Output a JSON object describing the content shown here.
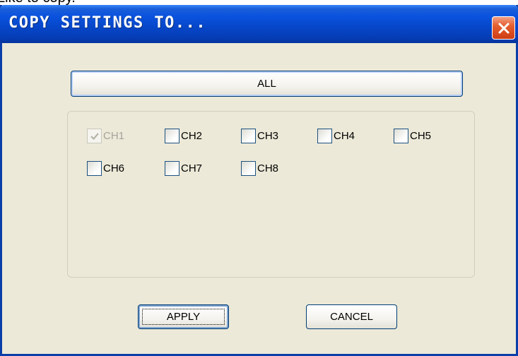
{
  "background_text": "Like to copy.",
  "dialog": {
    "title": "COPY SETTINGS TO...",
    "close_glyph": "close-icon"
  },
  "buttons": {
    "all_label": "ALL",
    "apply_label": "APPLY",
    "cancel_label": "CANCEL"
  },
  "channels": [
    {
      "label": "CH1",
      "checked": true,
      "enabled": false
    },
    {
      "label": "CH2",
      "checked": false,
      "enabled": true
    },
    {
      "label": "CH3",
      "checked": false,
      "enabled": true
    },
    {
      "label": "CH4",
      "checked": false,
      "enabled": true
    },
    {
      "label": "CH5",
      "checked": false,
      "enabled": true
    },
    {
      "label": "CH6",
      "checked": false,
      "enabled": true
    },
    {
      "label": "CH7",
      "checked": false,
      "enabled": true
    },
    {
      "label": "CH8",
      "checked": false,
      "enabled": true
    }
  ],
  "colors": {
    "title_bar": "#0a52de",
    "dialog_bg": "#ece9d8",
    "close_button": "#e5602f"
  }
}
